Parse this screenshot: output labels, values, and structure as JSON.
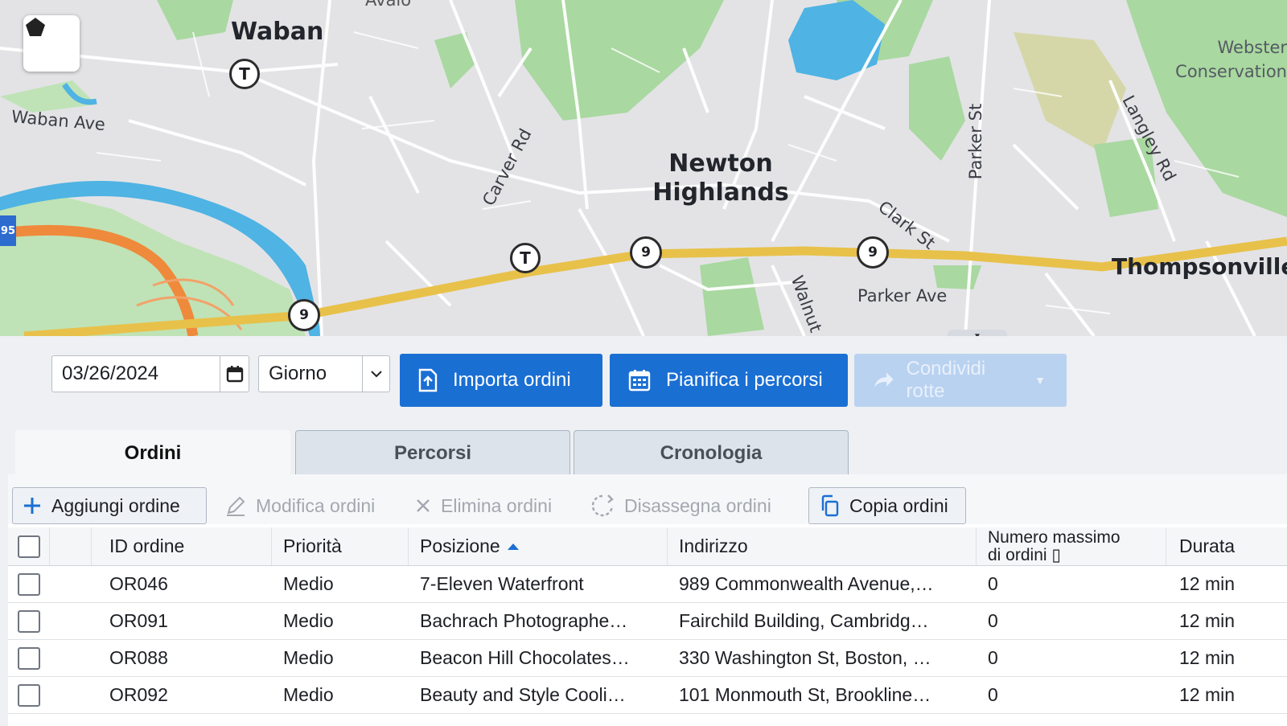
{
  "map": {
    "towns": [
      "Waban",
      "Newton Highlands",
      "Thompsonville"
    ],
    "streets": [
      "Waban Ave",
      "Carver Rd",
      "Clark St",
      "Parker St",
      "Langley Rd",
      "Parker Ave",
      "Walnut"
    ],
    "poi": "Webster Conservation",
    "route_shields": [
      "9",
      "9",
      "9"
    ],
    "transit_label": "T",
    "interstate_label": "95",
    "avalon_label": "Avalo",
    "draw_tool_icon": "polygon-icon"
  },
  "toolbar": {
    "date": "03/26/2024",
    "period": "Giorno",
    "import_label": "Importa ordini",
    "plan_label": "Pianifica i percorsi",
    "share_label": "Condividi rotte"
  },
  "tabs": [
    "Ordini",
    "Percorsi",
    "Cronologia"
  ],
  "grid_toolbar": {
    "add": "Aggiungi ordine",
    "edit": "Modifica ordini",
    "delete": "Elimina ordini",
    "unassign": "Disassegna ordini",
    "copy": "Copia ordini"
  },
  "table": {
    "columns": {
      "id": "ID ordine",
      "priority": "Priorità",
      "position": "Posizione",
      "address": "Indirizzo",
      "max_orders_1": "Numero massimo",
      "max_orders_2": "di ordini ▯",
      "duration": "Durata"
    },
    "rows": [
      {
        "id": "OR046",
        "priority": "Medio",
        "position": "7-Eleven Waterfront",
        "address": "989 Commonwealth Avenue,…",
        "max": "0",
        "duration": "12 min"
      },
      {
        "id": "OR091",
        "priority": "Medio",
        "position": "Bachrach Photographe…",
        "address": "Fairchild Building, Cambridg…",
        "max": "0",
        "duration": "12 min"
      },
      {
        "id": "OR088",
        "priority": "Medio",
        "position": "Beacon Hill Chocolates…",
        "address": "330 Washington St, Boston, …",
        "max": "0",
        "duration": "12 min"
      },
      {
        "id": "OR092",
        "priority": "Medio",
        "position": "Beauty and Style Cooli…",
        "address": "101 Monmouth St, Brookline…",
        "max": "0",
        "duration": "12 min"
      }
    ]
  },
  "colors": {
    "primary": "#1a6fd3",
    "highway": "#e8c14a",
    "interstate": "#ef8a3c",
    "water": "#4fb3e3",
    "park": "#9fd59a"
  }
}
